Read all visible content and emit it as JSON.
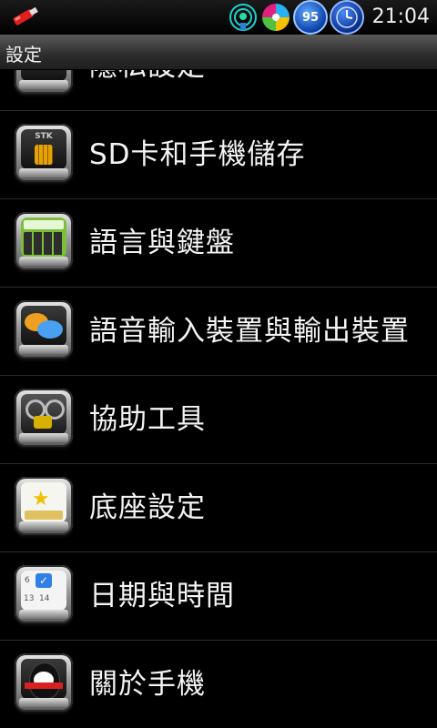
{
  "status": {
    "time": "21:04",
    "battery_level": "95",
    "icons": [
      "usb-icon",
      "signal-tower-icon",
      "pinwheel-icon",
      "battery-icon",
      "clock-icon"
    ]
  },
  "title": "設定",
  "settings": {
    "items": [
      {
        "label": "隱私設定",
        "icon": "privacy-icon"
      },
      {
        "label": "SD卡和手機儲存",
        "icon": "sim-card-icon",
        "icon_text": "STK"
      },
      {
        "label": "語言與鍵盤",
        "icon": "keyboard-icon"
      },
      {
        "label": "語音輸入裝置與輸出裝置",
        "icon": "speech-bubbles-icon"
      },
      {
        "label": "協助工具",
        "icon": "gears-icon"
      },
      {
        "label": "底座設定",
        "icon": "dock-icon"
      },
      {
        "label": "日期與時間",
        "icon": "calendar-icon",
        "icon_numbers": [
          "6",
          "13",
          "14"
        ]
      },
      {
        "label": "關於手機",
        "icon": "penguin-icon"
      }
    ]
  }
}
